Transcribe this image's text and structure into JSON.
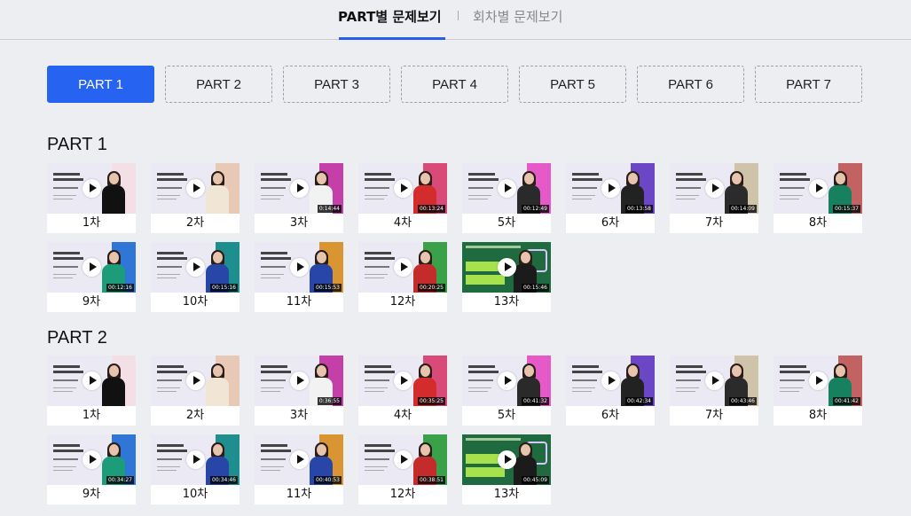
{
  "top_tabs": [
    {
      "label": "PART별 문제보기",
      "active": true
    },
    {
      "label": "회차별 문제보기",
      "active": false
    }
  ],
  "part_buttons": [
    "PART 1",
    "PART 2",
    "PART 3",
    "PART 4",
    "PART 5",
    "PART 6",
    "PART 7"
  ],
  "active_part": "PART 1",
  "accent_color": "#2563f0",
  "sections": [
    {
      "title": "PART 1",
      "videos": [
        {
          "label": "1차",
          "duration": ""
        },
        {
          "label": "2차",
          "duration": ""
        },
        {
          "label": "3차",
          "duration": "0:14:44"
        },
        {
          "label": "4차",
          "duration": "00:13:24"
        },
        {
          "label": "5차",
          "duration": "00:12:49"
        },
        {
          "label": "6차",
          "duration": "00:13:58"
        },
        {
          "label": "7차",
          "duration": "00:14:09"
        },
        {
          "label": "8차",
          "duration": "00:15:37"
        },
        {
          "label": "9차",
          "duration": "00:12:16"
        },
        {
          "label": "10차",
          "duration": "00:15:16"
        },
        {
          "label": "11차",
          "duration": "00:15:53"
        },
        {
          "label": "12차",
          "duration": "00:20:25"
        },
        {
          "label": "13차",
          "duration": "00:15:46"
        }
      ]
    },
    {
      "title": "PART 2",
      "videos": [
        {
          "label": "1차",
          "duration": ""
        },
        {
          "label": "2차",
          "duration": ""
        },
        {
          "label": "3차",
          "duration": "0:36:55"
        },
        {
          "label": "4차",
          "duration": "00:35:25"
        },
        {
          "label": "5차",
          "duration": "00:41:32"
        },
        {
          "label": "6차",
          "duration": "00:42:34"
        },
        {
          "label": "7차",
          "duration": "00:43:46"
        },
        {
          "label": "8차",
          "duration": "00:41:42"
        },
        {
          "label": "9차",
          "duration": "00:34:27"
        },
        {
          "label": "10차",
          "duration": "00:34:46"
        },
        {
          "label": "11차",
          "duration": "00:40:53"
        },
        {
          "label": "12차",
          "duration": "00:38:51"
        },
        {
          "label": "13차",
          "duration": "00:45:09"
        }
      ]
    }
  ]
}
